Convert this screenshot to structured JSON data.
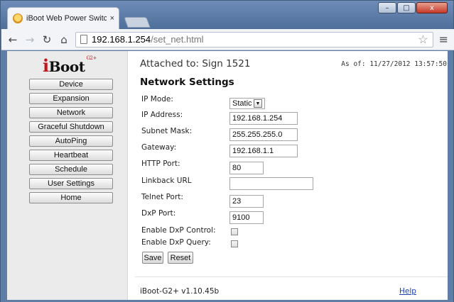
{
  "browser": {
    "tab_title": "iBoot Web Power Switch",
    "tab_close": "×",
    "url_host": "192.168.1.254",
    "url_path": "/set_net.html",
    "window_controls": {
      "minimize": "–",
      "maximize": "□",
      "close": "x"
    },
    "icons": [
      "back-icon",
      "forward-icon",
      "reload-icon",
      "home-icon",
      "page-icon",
      "star-icon",
      "menu-icon"
    ]
  },
  "logo": {
    "prefix": "i",
    "name": "Boot",
    "superscript": "G2+"
  },
  "nav": {
    "items": [
      {
        "label": "Device"
      },
      {
        "label": "Expansion"
      },
      {
        "label": "Network"
      },
      {
        "label": "Graceful Shutdown"
      },
      {
        "label": "AutoPing"
      },
      {
        "label": "Heartbeat"
      },
      {
        "label": "Schedule"
      },
      {
        "label": "User Settings"
      },
      {
        "label": "Home"
      }
    ]
  },
  "header": {
    "attached": "Attached to: Sign 1521",
    "as_of": "As of: 11/27/2012 13:57:50"
  },
  "form": {
    "title": "Network Settings",
    "ip_mode": {
      "label": "IP Mode:",
      "value": "Static"
    },
    "ip_address": {
      "label": "IP Address:",
      "value": "192.168.1.254"
    },
    "subnet_mask": {
      "label": "Subnet Mask:",
      "value": "255.255.255.0"
    },
    "gateway": {
      "label": "Gateway:",
      "value": "192.168.1.1"
    },
    "http_port": {
      "label": "HTTP Port:",
      "value": "80"
    },
    "linkback_url": {
      "label": "Linkback URL",
      "value": ""
    },
    "telnet_port": {
      "label": "Telnet Port:",
      "value": "23"
    },
    "dxp_port": {
      "label": "DxP Port:",
      "value": "9100"
    },
    "enable_dxp_control": {
      "label": "Enable DxP Control:",
      "checked": false
    },
    "enable_dxp_query": {
      "label": "Enable DxP Query:",
      "checked": false
    },
    "save_label": "Save",
    "reset_label": "Reset"
  },
  "footer": {
    "version": "iBoot-G2+ v1.10.45b",
    "help": "Help"
  }
}
